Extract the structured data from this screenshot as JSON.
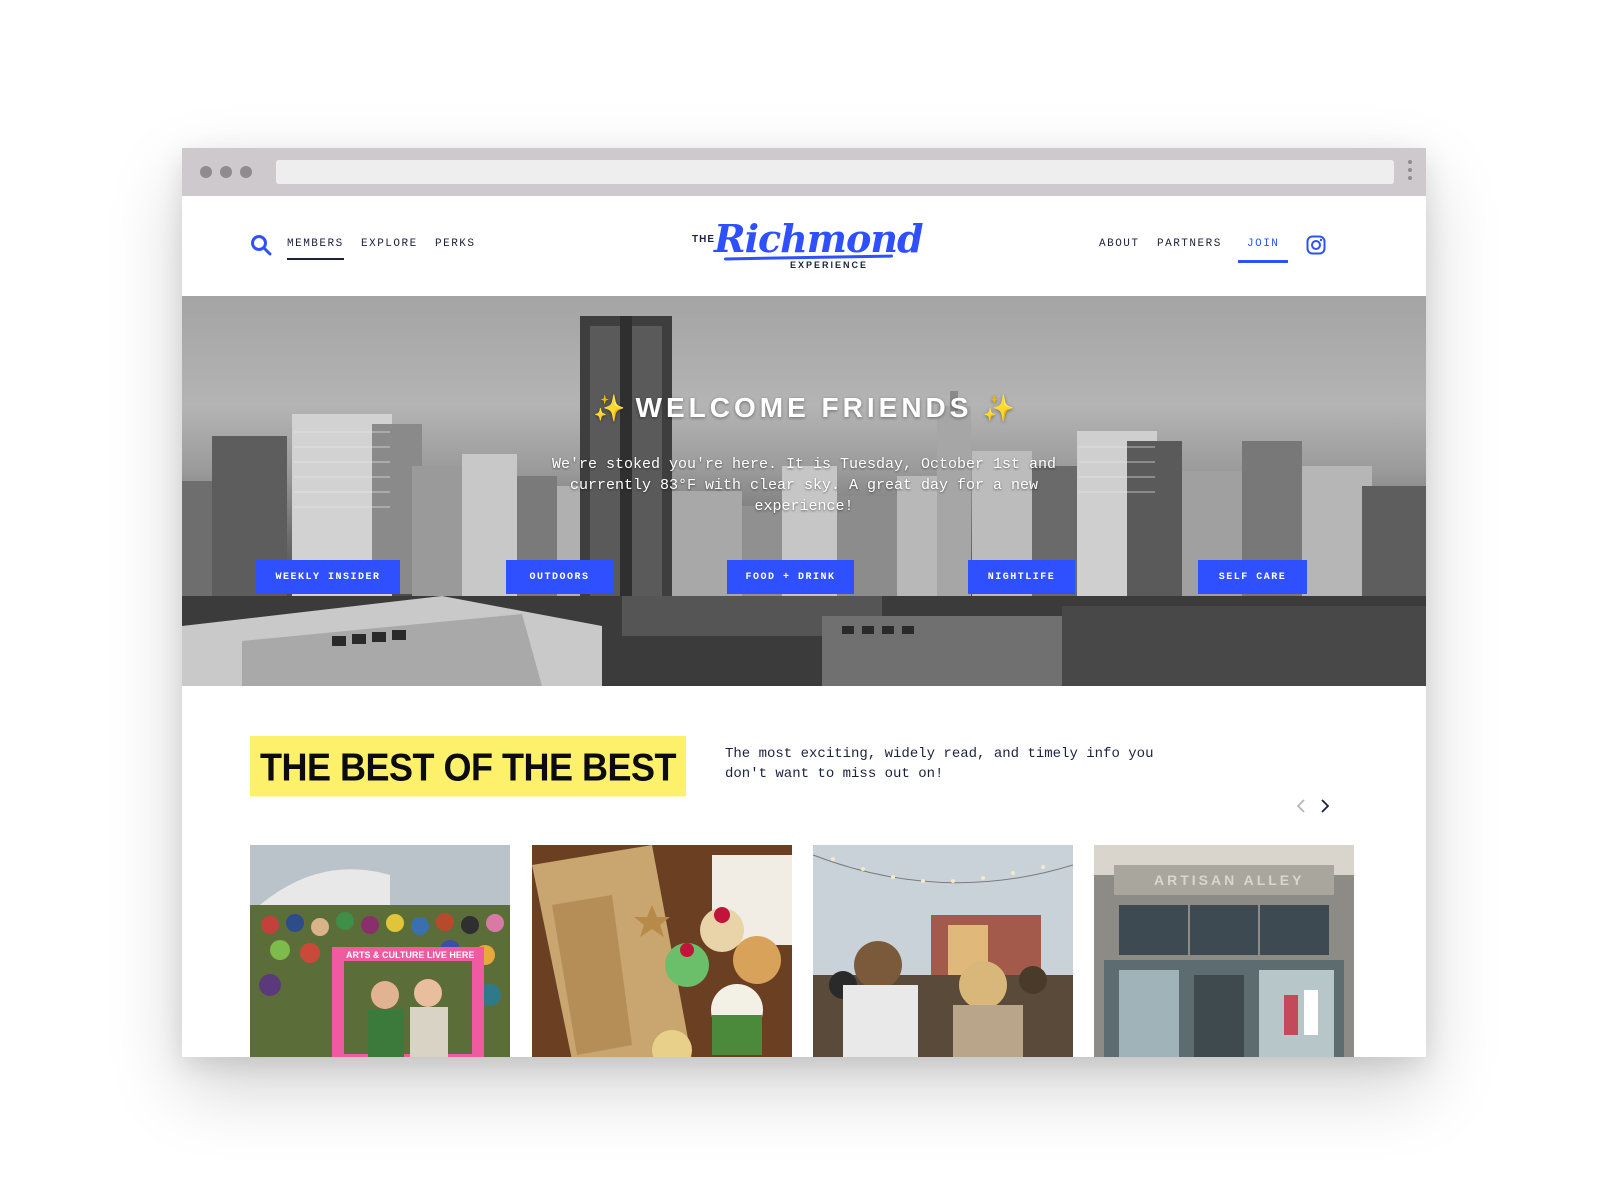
{
  "header": {
    "nav_left": [
      "MEMBERS",
      "EXPLORE",
      "PERKS"
    ],
    "nav_right": [
      "ABOUT",
      "PARTNERS"
    ],
    "join_label": "JOIN",
    "logo": {
      "the": "THE",
      "name": "Richmond",
      "sub": "EXPERIENCE"
    }
  },
  "hero": {
    "title": "WELCOME FRIENDS",
    "sparkle": "✨",
    "text": "We're stoked you're here. It is Tuesday, October 1st and currently 83°F with clear sky. A great day for a new experience!",
    "categories": [
      "WEEKLY INSIDER",
      "OUTDOORS",
      "FOOD + DRINK",
      "NIGHTLIFE",
      "SELF CARE"
    ]
  },
  "best": {
    "heading": "THE BEST OF THE BEST",
    "description": "The most exciting, widely read, and timely info you don't want to miss out on!",
    "card_signs": {
      "festival": "ARTS & CULTURE  LIVE HERE",
      "storefront": "ARTISAN ALLEY"
    }
  },
  "colors": {
    "accent": "#2f50ff",
    "navy": "#1b2240",
    "highlight": "#fdf16b"
  },
  "icons": [
    "search-icon",
    "instagram-icon",
    "chevron-left-icon",
    "chevron-right-icon"
  ]
}
